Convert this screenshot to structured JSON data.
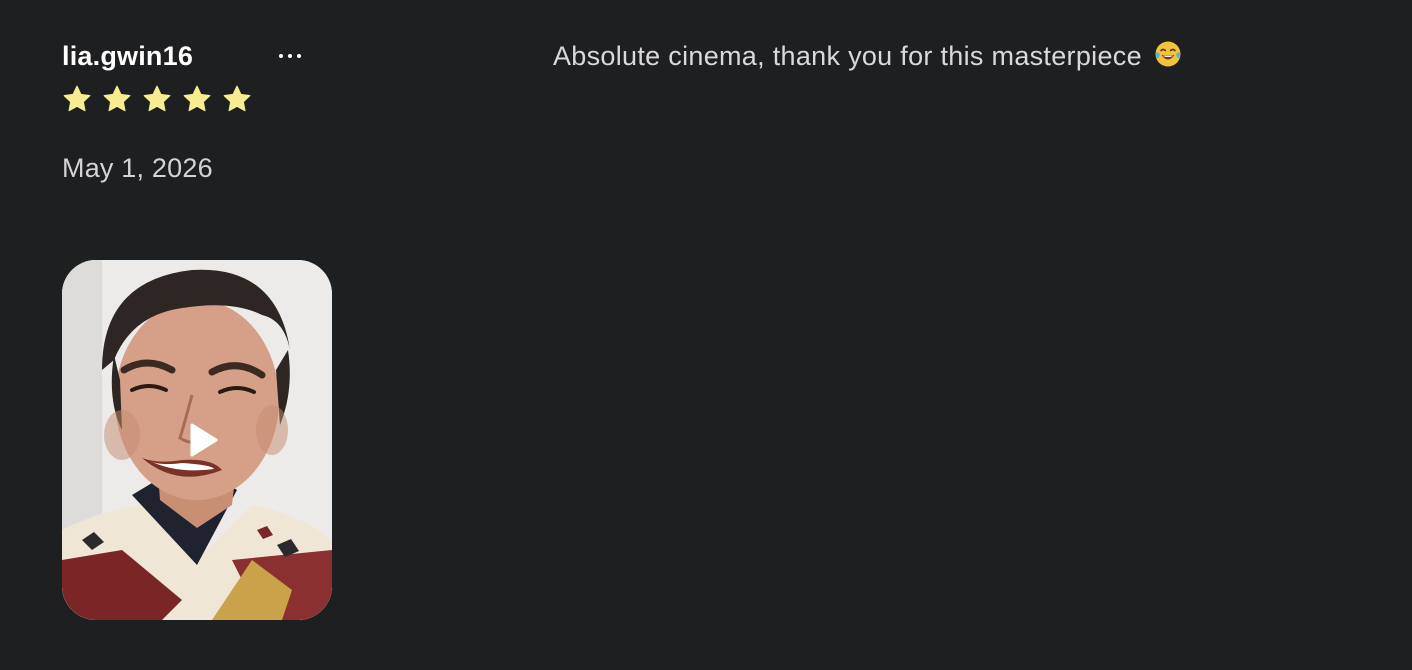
{
  "review": {
    "username": "lia.gwin16",
    "rating": 5,
    "rating_max": 5,
    "date": "May 1, 2026",
    "comment": "Absolute cinema, thank you for this masterpiece",
    "comment_emoji": "face-with-tears-of-joy-icon"
  },
  "icons": {
    "more": "more-options-icon",
    "star": "star-icon",
    "play": "play-icon"
  },
  "colors": {
    "background": "#1e1f21",
    "star": "#f7ec8f",
    "text_primary": "#ffffff",
    "text_secondary": "#d4d4d6"
  }
}
